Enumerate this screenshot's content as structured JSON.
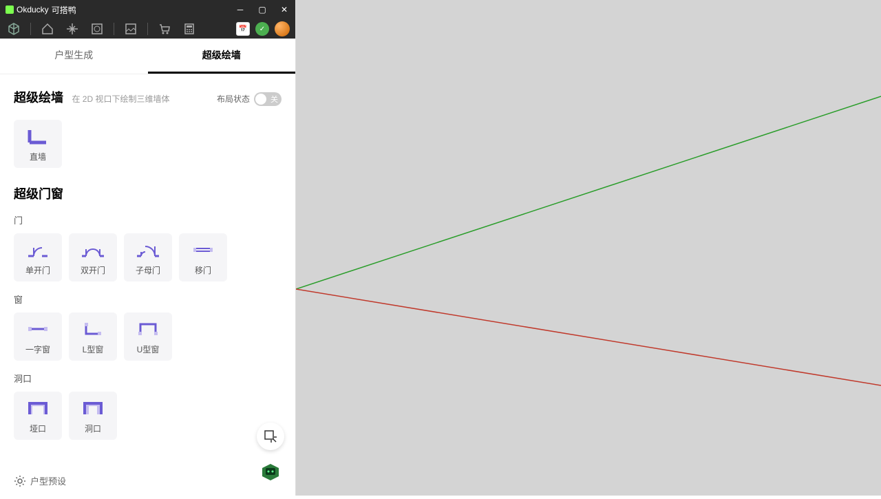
{
  "titlebar": {
    "brand": "Okducky",
    "brand_cn": "可搭鸭"
  },
  "tabs": {
    "t1": "户型生成",
    "t2": "超级绘墙"
  },
  "panel": {
    "title": "超级绘墙",
    "subtitle": "在 2D 视口下绘制三维墙体",
    "toggle_label": "布局状态",
    "toggle_off": "关"
  },
  "tools": {
    "wall": {
      "straight": "直墙"
    },
    "doorwin_title": "超级门窗",
    "door_sub": "门",
    "doors": {
      "single": "单开门",
      "double": "双开门",
      "mother": "子母门",
      "sliding": "移门"
    },
    "window_sub": "窗",
    "windows": {
      "straight": "一字窗",
      "l": "L型窗",
      "u": "U型窗"
    },
    "opening_sub": "洞口",
    "openings": {
      "arch": "垭口",
      "hole": "洞口"
    }
  },
  "footer": {
    "settings": "户型预设"
  }
}
